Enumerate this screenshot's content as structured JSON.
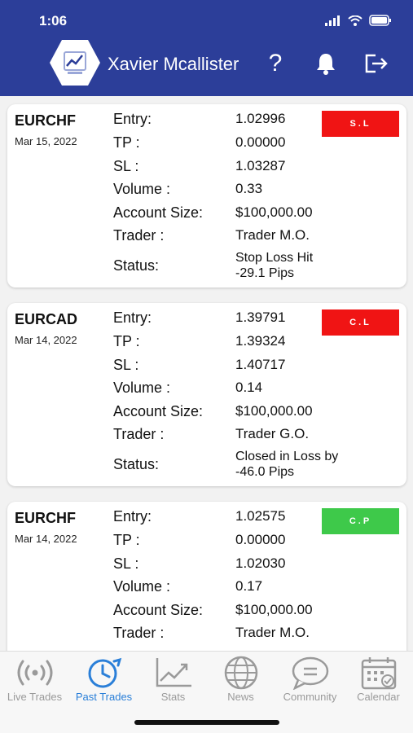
{
  "status_bar": {
    "time": "1:06"
  },
  "header": {
    "user_name": "Xavier Mcallister",
    "help_label": "?"
  },
  "labels": {
    "entry": "Entry:",
    "tp": "TP :",
    "sl": "SL :",
    "volume": "Volume :",
    "account_size": "Account Size:",
    "trader": "Trader :",
    "status": "Status:"
  },
  "trades": [
    {
      "symbol": "EURCHF",
      "date": "Mar 15, 2022",
      "entry": "1.02996",
      "tp": "0.00000",
      "sl": "1.03287",
      "volume": "0.33",
      "account_size": "$100,000.00",
      "trader": "Trader M.O.",
      "status_line1": "Stop Loss Hit",
      "status_line2": "-29.1 Pips",
      "badge": "S.L",
      "badge_color": "#f01414"
    },
    {
      "symbol": "EURCAD",
      "date": "Mar 14, 2022",
      "entry": "1.39791",
      "tp": "1.39324",
      "sl": "1.40717",
      "volume": "0.14",
      "account_size": "$100,000.00",
      "trader": "Trader G.O.",
      "status_line1": "Closed in Loss by",
      "status_line2": "-46.0 Pips",
      "badge": "C.L",
      "badge_color": "#f01414"
    },
    {
      "symbol": "EURCHF",
      "date": "Mar 14, 2022",
      "entry": "1.02575",
      "tp": "0.00000",
      "sl": "1.02030",
      "volume": "0.17",
      "account_size": "$100,000.00",
      "trader": "Trader M.O.",
      "badge": "C.P",
      "badge_color": "#3ec94a"
    }
  ],
  "tabs": [
    {
      "label": "Live Trades",
      "icon": "broadcast-icon"
    },
    {
      "label": "Past Trades",
      "icon": "clock-history-icon"
    },
    {
      "label": "Stats",
      "icon": "chart-line-icon"
    },
    {
      "label": "News",
      "icon": "globe-icon"
    },
    {
      "label": "Community",
      "icon": "chat-bubble-icon"
    },
    {
      "label": "Calendar",
      "icon": "calendar-icon"
    }
  ],
  "active_tab": "Past Trades",
  "colors": {
    "header_bg": "#2c3e99",
    "active_tab": "#2a7fd8",
    "inactive_tab": "#9a9a9a",
    "loss_badge": "#f01414",
    "profit_badge": "#3ec94a"
  }
}
